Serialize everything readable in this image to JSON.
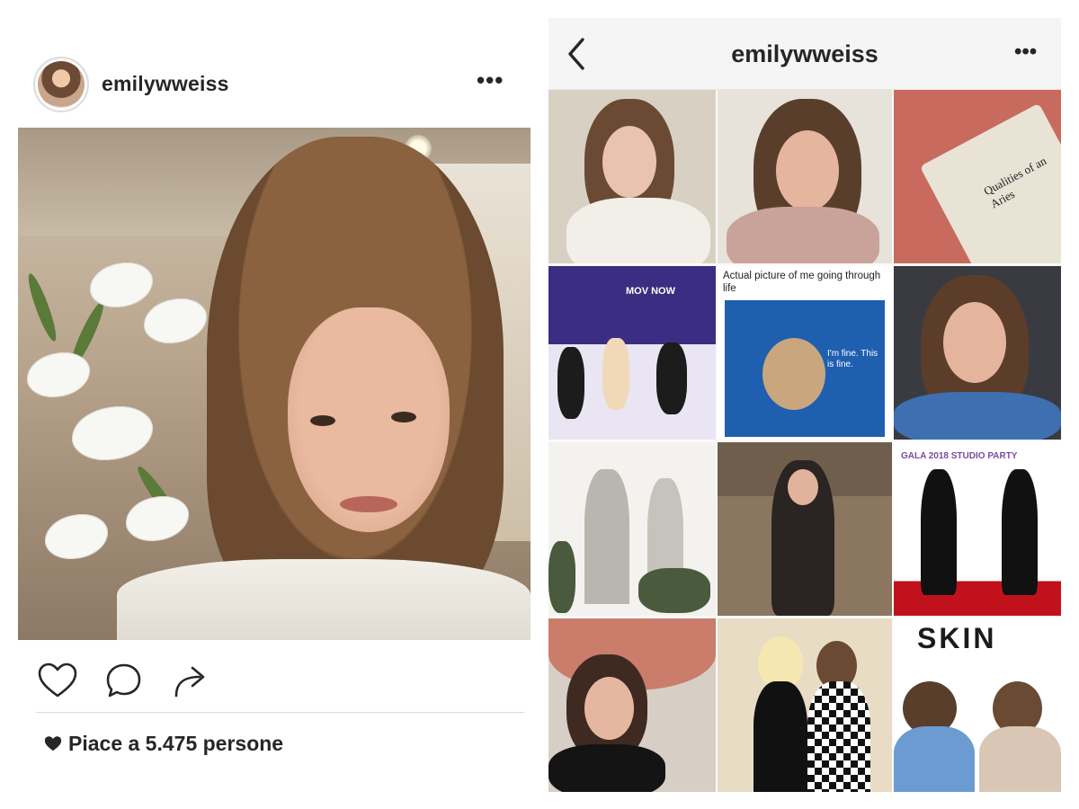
{
  "post": {
    "username": "emilywweiss",
    "more_icon": "more-horizontal-icon",
    "actions": {
      "like_icon": "heart-outline-icon",
      "comment_icon": "comment-bubble-icon",
      "share_icon": "share-arrow-icon"
    },
    "likes_text": "Piace a 5.475 persone",
    "likes_icon": "heart-filled-icon"
  },
  "profile": {
    "title": "emilywweiss",
    "back_icon": "chevron-left-icon",
    "more_icon": "more-horizontal-icon",
    "tiles": [
      {
        "kind": "selfie",
        "colors": [
          "#d9d0c4",
          "#6b4a33",
          "#e9c3ad",
          "#f2efe9"
        ]
      },
      {
        "kind": "selfie",
        "colors": [
          "#e7e2da",
          "#5a3e2c",
          "#e6b59e",
          "#c9a39a"
        ]
      },
      {
        "kind": "book",
        "colors": [
          "#c96a5f",
          "#e9e3d6"
        ],
        "text": "Qualities of an Aries"
      },
      {
        "kind": "event",
        "colors": [
          "#3b2e82",
          "#e9e5f3"
        ],
        "text": "MOV NOW"
      },
      {
        "kind": "meme",
        "colors": [
          "#1e5fb0",
          "#ffffff"
        ],
        "caption": "Actual picture of me going through life",
        "text": "I'm fine. This is fine."
      },
      {
        "kind": "selfie",
        "colors": [
          "#3a3b40",
          "#5b3d2a",
          "#e4b49c",
          "#3d6fb1"
        ]
      },
      {
        "kind": "building",
        "colors": [
          "#f3f2ee",
          "#4a5a3c"
        ]
      },
      {
        "kind": "store",
        "colors": [
          "#8b7660",
          "#2a2522"
        ]
      },
      {
        "kind": "redcarpet",
        "colors": [
          "#c1121c",
          "#ffffff",
          "#111111"
        ],
        "text": "GALA 2018 STUDIO PARTY"
      },
      {
        "kind": "selfie",
        "colors": [
          "#d7cfc6",
          "#3e2a20",
          "#e6b7a0",
          "#141414"
        ]
      },
      {
        "kind": "friends",
        "colors": [
          "#e9dcc5",
          "#111111",
          "#f6e7b0"
        ]
      },
      {
        "kind": "skin",
        "colors": [
          "#ffffff",
          "#111111",
          "#6b9bd1"
        ],
        "text": "SKIN"
      }
    ]
  }
}
